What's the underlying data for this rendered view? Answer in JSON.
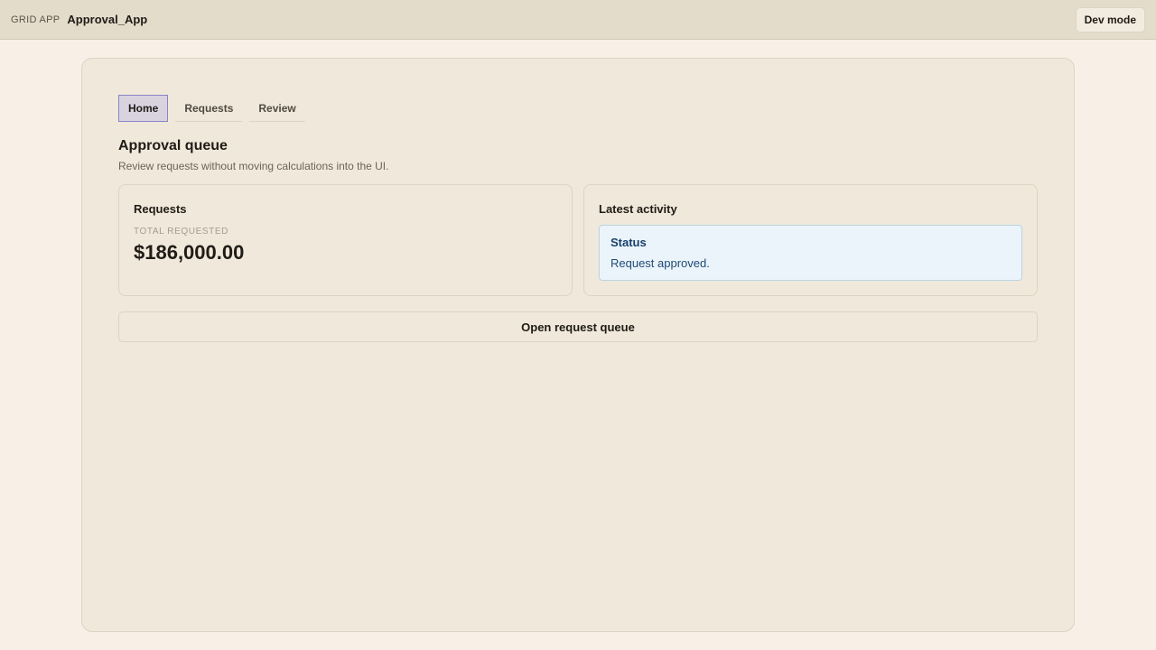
{
  "header": {
    "brand": "GRID APP",
    "app_name": "Approval_App",
    "dev_mode_label": "Dev mode"
  },
  "tabs": [
    {
      "label": "Home",
      "active": true
    },
    {
      "label": "Requests",
      "active": false
    },
    {
      "label": "Review",
      "active": false
    }
  ],
  "page": {
    "title": "Approval queue",
    "subtitle": "Review requests without moving calculations into the UI."
  },
  "requests_card": {
    "title": "Requests",
    "metric_label": "TOTAL REQUESTED",
    "metric_value": "$186,000.00"
  },
  "activity_card": {
    "title": "Latest activity",
    "status_title": "Status",
    "status_text": "Request approved."
  },
  "actions": {
    "open_queue_label": "Open request queue"
  },
  "colors": {
    "accent_tab_border": "#8a84c6",
    "status_bg": "#ebf4fb",
    "status_text": "#17406b"
  }
}
